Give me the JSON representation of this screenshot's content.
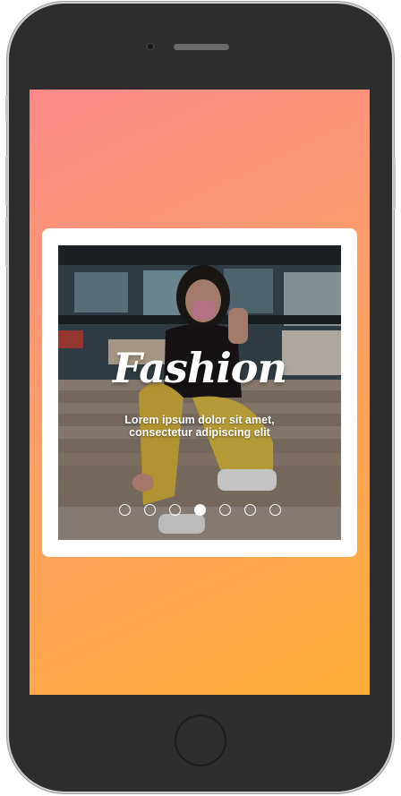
{
  "slide": {
    "title": "Fashion",
    "subtitle": "Lorem ipsum dolor sit amet, consectetur adipiscing elit"
  },
  "pagination": {
    "total": 7,
    "active_index": 3
  },
  "colors": {
    "gradient_start": "#fd8a8a",
    "gradient_end": "#fdae38",
    "card": "#ffffff",
    "phone_body": "#2d2d2d"
  }
}
